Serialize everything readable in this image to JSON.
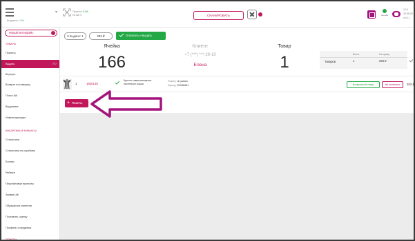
{
  "topbar": {
    "subtitle_prefix": "Выдавать с",
    "subtitle_value": "0%",
    "stat_1_label": "Принято",
    "stat_1_value": "5 ШК",
    "stat_2_label": "Из ШК",
    "stat_2_value": "0",
    "scan_button": "СКАНИРОВАТЬ",
    "online_label": "онлайн",
    "right_line_1": "12:3",
    "right_line_2": "29.09.20",
    "right_line_3": "v4.5.1"
  },
  "sidebar": {
    "new_interface": "Новый интерфейс",
    "section_goods": "Товары",
    "items_goods": [
      "Принять",
      "Выдать",
      "Вернуть",
      "Возврат поставщику",
      "Поиск ШК",
      "Выданные",
      "Инвентаризация"
    ],
    "active_badge": "777",
    "section_analytics": "Аналитика и финансы",
    "items_analytics": [
      "Статистика",
      "Статистика по коробкам",
      "Баланс",
      "Рейтинг",
      "Персейловые выплаты",
      "Заявки ШК",
      "Обращения клиентов",
      "Поставить оценку",
      "Профиль сотрудника"
    ],
    "section_help": "Помощь"
  },
  "toolbar": {
    "chip_issue": "К выдаче: 1",
    "chip_sum": "283 ₽",
    "pay_button": "Оплатить и выдать"
  },
  "summary": {
    "cell_label": "Ячейка",
    "cell_value": "166",
    "client_label": "Клиент",
    "client_phone": "+7 (***) ***-29-10",
    "client_name": "Елена",
    "goods_label": "Товар",
    "goods_value": "1",
    "table_head_total": "Всего:",
    "table_head_sum": "На сумму",
    "table_row_label": "Товаров",
    "table_row_total": "1",
    "table_row_sum": "283 ₽"
  },
  "goods_row": {
    "index": "1",
    "article": "1820135",
    "name": "Кресло самоклеющееся настенные кошки",
    "size_label": "Размер:",
    "size_value": "не указан",
    "barcode_label": "Баркод:",
    "barcode_value": "203180461",
    "return_button": "Возвратный товар",
    "unmark_button": "Не оплачено",
    "price": "283 ₽"
  },
  "packages_button": "Пакеты",
  "colors": {
    "accent": "#c2185b",
    "success": "#22a845",
    "arrow": "#a3147d",
    "background": "#ececec"
  }
}
